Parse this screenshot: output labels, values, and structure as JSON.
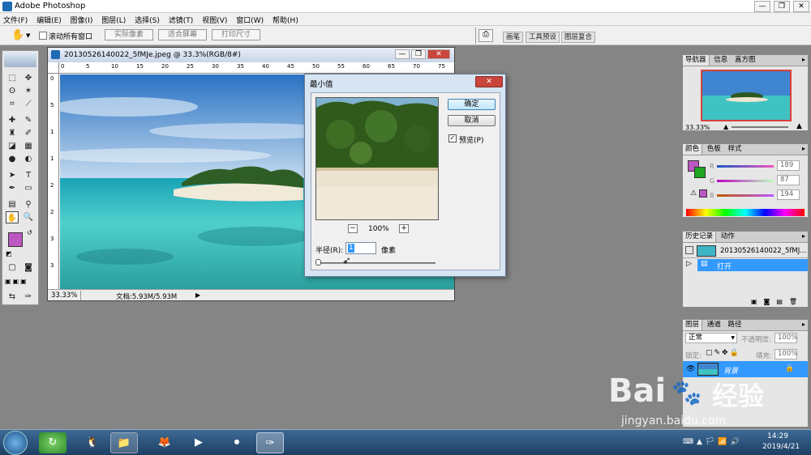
{
  "app": {
    "title": "Adobe Photoshop"
  },
  "window_controls": {
    "minimize": "—",
    "restore": "❐",
    "close": "✕"
  },
  "menu": [
    "文件(F)",
    "编辑(E)",
    "图像(I)",
    "图层(L)",
    "选择(S)",
    "滤镜(T)",
    "视图(V)",
    "窗口(W)",
    "帮助(H)"
  ],
  "options": {
    "checkbox_label": "滚动所有窗口",
    "btn_actual": "实际像素",
    "btn_fit": "适合屏幕",
    "btn_print": "打印尺寸",
    "well_tabs": [
      "画笔",
      "工具预设",
      "图层复合"
    ]
  },
  "document": {
    "title": "20130526140022_5fMJe.jpeg @ 33.3%(RGB/8#)",
    "ruler_top": [
      "0",
      "5",
      "10",
      "15",
      "20",
      "25",
      "30",
      "35",
      "40",
      "45",
      "50",
      "55",
      "60",
      "65",
      "70",
      "75"
    ],
    "ruler_left": [
      "0",
      "5",
      "1",
      "1",
      "2",
      "2",
      "3",
      "3"
    ],
    "zoom": "33.33%",
    "doc_size": "文档:5.93M/5.93M"
  },
  "dialog": {
    "title": "最小值",
    "ok": "确定",
    "cancel": "取消",
    "preview_label": "预览(P)",
    "preview_checked": true,
    "zoom_minus": "−",
    "zoom_plus": "+",
    "zoom_value": "100%",
    "radius_label": "半径(R):",
    "radius_value": "1",
    "radius_unit": "像素",
    "slider_level": 0.0,
    "close": "✕"
  },
  "navigator": {
    "tabs": [
      "导航器",
      "信息",
      "直方图"
    ],
    "zoom": "33.33%"
  },
  "color": {
    "tabs": [
      "颜色",
      "色板",
      "样式"
    ],
    "channels": [
      {
        "label": "R",
        "value": "189"
      },
      {
        "label": "G",
        "value": "87"
      },
      {
        "label": "B",
        "value": "194"
      }
    ],
    "fg_color": "#bd57c2",
    "bg_color": "#1fa51f"
  },
  "history": {
    "tabs": [
      "历史记录",
      "动作"
    ],
    "snapshot": "20130526140022_5fMJ...",
    "item": "打开"
  },
  "layers": {
    "tabs": [
      "图层",
      "通道",
      "路径"
    ],
    "blend_mode": "正常",
    "opacity_label": "不透明度:",
    "opacity": "100%",
    "lock_label": "锁定:",
    "fill_label": "填充:",
    "fill": "100%",
    "layer_name": "背景"
  },
  "taskbar": {
    "time": "14:29",
    "date": "2019/4/21"
  },
  "watermark": {
    "brand": "Bai",
    "brand2": "经验",
    "url": "jingyan.baidu.com"
  },
  "colors": {
    "selection": "#3399ff",
    "accent": "#1d6ab5"
  }
}
